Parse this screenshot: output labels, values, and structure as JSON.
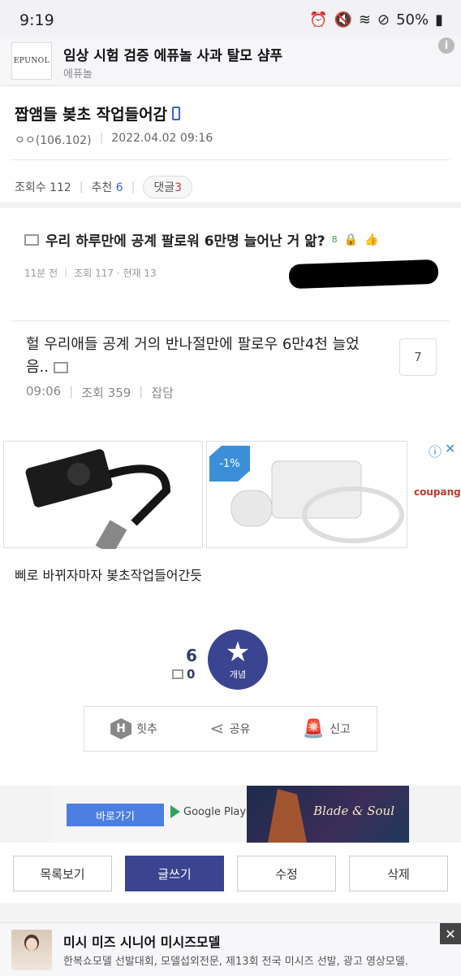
{
  "status_bar": {
    "time": "9:19",
    "battery": "50%",
    "icons": [
      "alarm-icon",
      "mute-icon",
      "wifi-icon",
      "dnd-icon",
      "battery-icon"
    ]
  },
  "top_ad": {
    "logo_text": "EPUNOL",
    "title": "임상 시험 검증 에퓨놀 사과 탈모 샴푸",
    "advertiser": "에퓨놀",
    "info_label": "i"
  },
  "post": {
    "title": "짭앰들 봊초 작업들어감",
    "author": "ㅇㅇ(106.102)",
    "date": "2022.04.02 09:16",
    "views_label": "조회수 112",
    "recommend_label": "추천",
    "recommend_count": "6",
    "reply_label": "댓글",
    "reply_count": "3",
    "body": "삐로 바뀌자마자 봊초작업들어간듯"
  },
  "related": [
    {
      "title": "우리 하루만에 공계 팔로워 6만명 늘어난 거 앎?",
      "badge": "8",
      "time": "11분 전",
      "views": "조회 117 · 현재 13"
    },
    {
      "title": "헐 우리애들 공계 거의 반나절만에 팔로우 6만4천 늘었음..",
      "time": "09:06",
      "views": "조회 359",
      "category": "잡담",
      "count": "7"
    }
  ],
  "product_ad": {
    "discount": "-1%",
    "brand": "coupang",
    "info_label": "ⓘ",
    "close_label": "✕"
  },
  "recommend": {
    "count": "6",
    "fix_count": "0",
    "button_label": "개념",
    "star": "★"
  },
  "actions": {
    "hit": "힛추",
    "hit_icon_letter": "H",
    "share": "공유",
    "report": "신고"
  },
  "game_ad": {
    "go_label": "바로가기",
    "store_label": "Google Play",
    "game_title": "Blade & Soul"
  },
  "buttons": {
    "list": "목록보기",
    "write": "글쓰기",
    "edit": "수정",
    "delete": "삭제"
  },
  "bottom_ad": {
    "title": "미시 미즈 시니어 미시즈모델",
    "desc": "한복쇼모델 선발대회, 모델섭외전문, 제13회 전국 미시즈 선발, 광고 영상모델.",
    "close_label": "✕"
  },
  "colors": {
    "accent_navy": "#3a4490",
    "link_blue": "#3c63c9",
    "reply_red": "#dd3333"
  }
}
